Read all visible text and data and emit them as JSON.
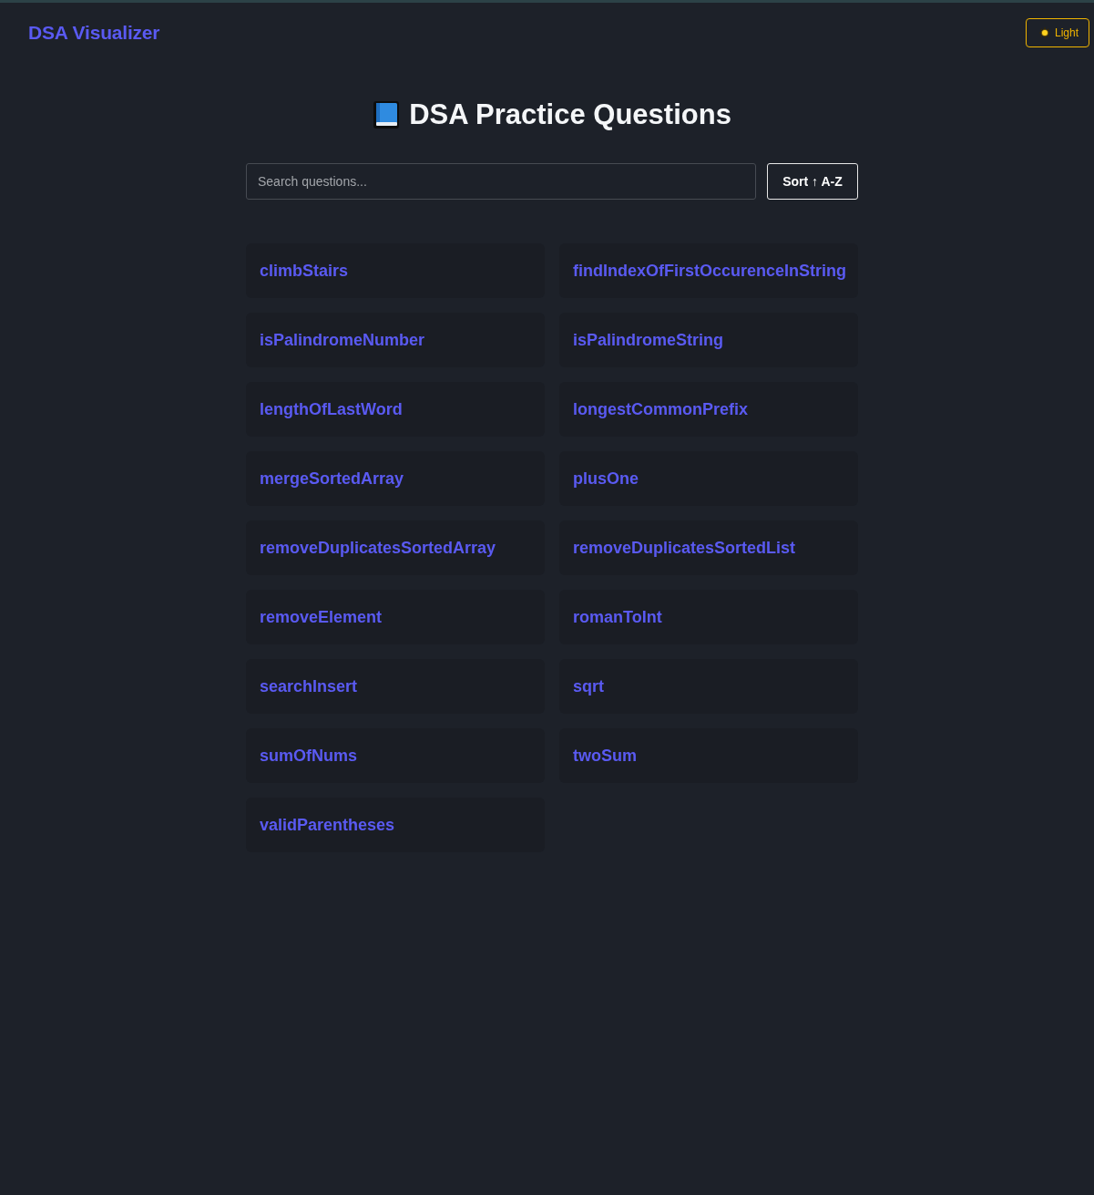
{
  "header": {
    "title": "DSA Visualizer",
    "theme_button": {
      "label": "Light"
    }
  },
  "page": {
    "heading": "DSA Practice Questions",
    "search": {
      "placeholder": "Search questions..."
    },
    "sort_button": {
      "label": "Sort ↑ A-Z"
    }
  },
  "questions": [
    {
      "name": "climbStairs"
    },
    {
      "name": "findIndexOfFirstOccurenceInString"
    },
    {
      "name": "isPalindromeNumber"
    },
    {
      "name": "isPalindromeString"
    },
    {
      "name": "lengthOfLastWord"
    },
    {
      "name": "longestCommonPrefix"
    },
    {
      "name": "mergeSortedArray"
    },
    {
      "name": "plusOne"
    },
    {
      "name": "removeDuplicatesSortedArray"
    },
    {
      "name": "removeDuplicatesSortedList"
    },
    {
      "name": "removeElement"
    },
    {
      "name": "romanToInt"
    },
    {
      "name": "searchInsert"
    },
    {
      "name": "sqrt"
    },
    {
      "name": "sumOfNums"
    },
    {
      "name": "twoSum"
    },
    {
      "name": "validParentheses"
    }
  ]
}
